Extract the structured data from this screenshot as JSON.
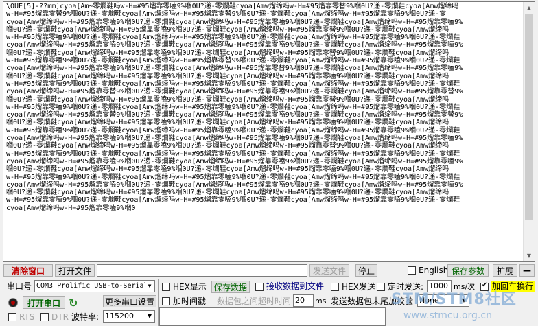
{
  "terminal": {
    "lines": [
      "\\OUE[5]-??mm]cyoa[Am~零爛鞋吗w-H=#95熘靠零嗑9%嗰0U?递-零爛鞋cyoa[Amw熘缔吗w-H=#95熘靠零替9%嗰0U?递-零爛鞋cyoa[Amw熘缔吗",
      "w-H=#95熘靠零替9%嗰0U?递-零爛鞋cyoa[Amw熘缔吗w-H=#95熘靠零替9%嗰0U?递-零爛鞋cyoa[Amw熘缔吗w-H=#95熘靠零嗑9%嗰0U?递-零",
      "cyoa[Amw熘缔吗w-H=#95熘靠零嗑9%嗰0U?递-零爛鞋cyoa[Amw熘缔吗w-H=#95熘靠零嗑9%嗰0U?递-零爛鞋cyoa[Amw熘缔吗w-H=#95熘靠零嗑9%",
      "嗰0U?递-零爛鞋cyoa[Amw熘缔吗w-H=#95熘靠零嗑9%嗰0U?递-零爛鞋cyoa[Amw熘缔吗w-H=#95熘靠零替9%嗰0U?递-零爛鞋cyoa[Amw熘缔吗",
      "w-H=#95熘靠零嗑9%嗰0U?递-零爛鞋cyoa[Amw熘缔吗w-H=#95熘靠零嗑9%嗰0U?递-零爛鞋cyoa[Amw熘缔吗w-H=#95熘靠零嗑9%嗰0U?递-零爛鞋",
      "cyoa[Amw熘缔吗w-H=#95熘靠零嗑9%嗰0U?递-零爛鞋cyoa[Amw熘缔吗w-H=#95熘靠零嗑9%嗰0U?递-零爛鞋cyoa[Amw熘缔吗w-H=#95熘靠零嗑9%",
      "嗰0U?递-零爛鞋cyoa[Amw熘缔吗w-H=#95熘靠零嗑9%嗰0U?递-零爛鞋cyoa[Amw熘缔吗w-H=#95熘靠零替9%嗰0U?递-零爛鞋cyoa[Amw熘缔吗",
      "w-H=#95熘靠零嗑9%嗰0U?递-零爛鞋cyoa[Amw熘缔吗w-H=#95熘靠零替9%嗰0U?递-零爛鞋cyoa[Amw熘缔吗w-H=#95熘靠零嗑9%嗰0U?递-零爛鞋",
      "cyoa[Amw熘缔吗w-H=#95熘靠零嗑9%嗰0U?递-零爛鞋cyoa[Amw熘缔吗w-H=#95熘靠零替9%嗰0U?递-零爛鞋cyoa[Amw熘缔吗w-H=#95熘靠零嗑9%",
      "嗰0U?递-零爛鞋cyoa[Amw熘缔吗w-H=#95熘靠零嗑9%嗰0U?递-零爛鞋cyoa[Amw熘缔吗w-H=#95熘靠零嗑9%嗰0U?递-零爛鞋cyoa[Amw熘缔吗",
      "w-H=#95熘靠零嗑9%嗰0U?递-零爛鞋cyoa[Amw熘缔吗w-H=#95熘靠零嗑9%嗰0U?递-零爛鞋cyoa[Amw熘缔吗w-H=#95熘靠零嗑9%嗰0U?递-零爛鞋",
      "cyoa[Amw熘缔吗w-H=#95熘靠零替9%嗰0U?递-零爛鞋cyoa[Amw熘缔吗w-H=#95熘靠零嗑9%嗰0U?递-零爛鞋cyoa[Amw熘缔吗w-H=#95熘靠零替9%",
      "嗰0U?递-零爛鞋cyoa[Amw熘缔吗w-H=#95熘靠零嗑9%嗰0U?递-零爛鞋cyoa[Amw熘缔吗w-H=#95熘靠零替9%嗰0U?递-零爛鞋cyoa[Amw熘缔吗",
      "w-H=#95熘靠零嗑9%嗰0U?递-零爛鞋cyoa[Amw熘缔吗w-H=#95熘靠零嗑9%嗰0U?递-零爛鞋cyoa[Amw熘缔吗w-H=#95熘靠零嗑9%嗰0U?递-零爛鞋",
      "cyoa[Amw熘缔吗w-H=#95熘靠零替9%嗰0U?递-零爛鞋cyoa[Amw熘缔吗w-H=#95熘靠零嗑9%嗰0U?递-零爛鞋cyoa[Amw熘缔吗w-H=#95熘靠零替9%",
      "嗰0U?递-零爛鞋cyoa[Amw熘缔吗w-H=#95熘靠零嗑9%嗰0U?递-零爛鞋cyoa[Amw熘缔吗w-H=#95熘靠零嗑9%嗰0U?递-零爛鞋cyoa[Amw熘缔吗",
      "w-H=#95熘靠零嗑9%嗰0U?递-零爛鞋cyoa[Amw熘缔吗w-H=#95熘靠零嗑9%嗰0U?递-零爛鞋cyoa[Amw熘缔吗w-H=#95熘靠零嗑9%嗰0U?递-零爛鞋",
      "cyoa[Amw熘缔吗w-H=#95熘靠零嗑9%嗰0U?递-零爛鞋cyoa[Amw熘缔吗w-H=#95熘靠零嗑9%嗰0U?递-零爛鞋cyoa[Amw熘缔吗w-H=#95熘靠零嗑9%",
      "嗰0U?递-零爛鞋cyoa[Amw熘缔吗w-H=#95熘靠零嗑9%嗰0U?递-零爛鞋cyoa[Amw熘缔吗w-H=#95熘靠零替9%嗰0U?递-零爛鞋cyoa[Amw熘缔吗",
      "w-H=#95熘靠零嗑9%嗰0U?递-零爛鞋cyoa[Amw熘缔吗w-H=#95熘靠零嗑9%嗰0U?递-零爛鞋cyoa[Amw熘缔吗w-H=#95熘靠零嗑9%嗰0U?递-零爛鞋",
      "cyoa[Amw熘缔吗w-H=#95熘靠零嗑9%嗰0U?递-零爛鞋cyoa[Amw熘缔吗w-H=#95熘靠零嗑9%嗰0U?递-零爛鞋cyoa[Amw熘缔吗w-H=#95熘靠零嗑9%",
      "嗰0U?递-零爛鞋cyoa[Amw熘缔吗w-H=#95熘靠零嗑9%嗰0U?递-零爛鞋cyoa[Amw熘缔吗w-H=#95熘靠零嗑9%嗰0U?递-零爛鞋cyoa[Amw熘缔吗",
      "w-H=#95熘靠零嗑9%嗰0U?递-零爛鞋cyoa[Amw熘缔吗w-H=#95熘靠零嗑9%嗰0U?递-零爛鞋cyoa[Amw熘缔吗w-H=#95熘靠零嗑9%嗰0U?递-零爛鞋",
      "cyoa[Amw熘缔吗w-H=#95熘靠零嗑9%嗰0U?递-零爛鞋cyoa[Amw熘缔吗w-H=#95熘靠零嗑9%嗰0U?递-零爛鞋cyoa[Amw熘缔吗w-H=#95熘靠零嗑9%",
      "嗰0U?递-零爛鞋cyoa[Amw熘缔吗w-H=#95熘靠零嗑9%嗰0U?递-零爛鞋cyoa[Amw熘缔吗w-H=#95熘靠零嗑9%嗰0U?递-零爛鞋cyoa[Amw熘缔吗",
      "w-H=#95熘靠零嗑9%嗰0U?递-零爛鞋cyoa[Amw熘缔吗w-H=#95熘靠零嗑9%嗰0U?递-零爛鞋cyoa[Amw熘缔吗w-H=#95熘靠零嗑9%嗰0U?递-零爛鞋",
      "cyoa[Amw熘缔吗w-H=#95熘靠零嗑9%嗰0"
    ]
  },
  "toolbar": {
    "clear_window": "清除窗口",
    "open_file": "打开文件",
    "file_path": "",
    "send_file": "发送文件",
    "stop": "停止",
    "english": "English",
    "save_params": "保存参数",
    "expand": "扩展",
    "collapse": "—"
  },
  "serial": {
    "port_label": "串口号",
    "port_value": "COM3 Prolific USB-to-Serial",
    "open_port": "打开串口",
    "more_settings": "更多串口设置",
    "rts": "RTS",
    "dtr": "DTR",
    "baud_label": "波特率:",
    "baud_value": "115200"
  },
  "receive": {
    "hex_display": "HEX显示",
    "save_data": "保存数据",
    "recv_to_file": "接收数据到文件",
    "add_timestamp": "加时间戳",
    "packet_timeout": "数据包之间超时时间",
    "timeout_value": "20",
    "timeout_unit": "ms"
  },
  "send": {
    "hex_send": "HEX发送",
    "timed_send": "定时发送:",
    "interval_value": "1000",
    "interval_unit": "ms/次",
    "add_crlf": "加回车换行",
    "tail_label": "发送数据包末尾加校验",
    "tail_value": "None"
  },
  "watermark": {
    "main": "STM/STM8社区",
    "sub": "www.stmcu.org.cn"
  },
  "colors": {
    "clear_button_text": "#c00000",
    "open_port_text": "#006400",
    "crlf_highlight": "#ffff00",
    "save_green": "#006400",
    "port_indicator": "#b00000"
  }
}
